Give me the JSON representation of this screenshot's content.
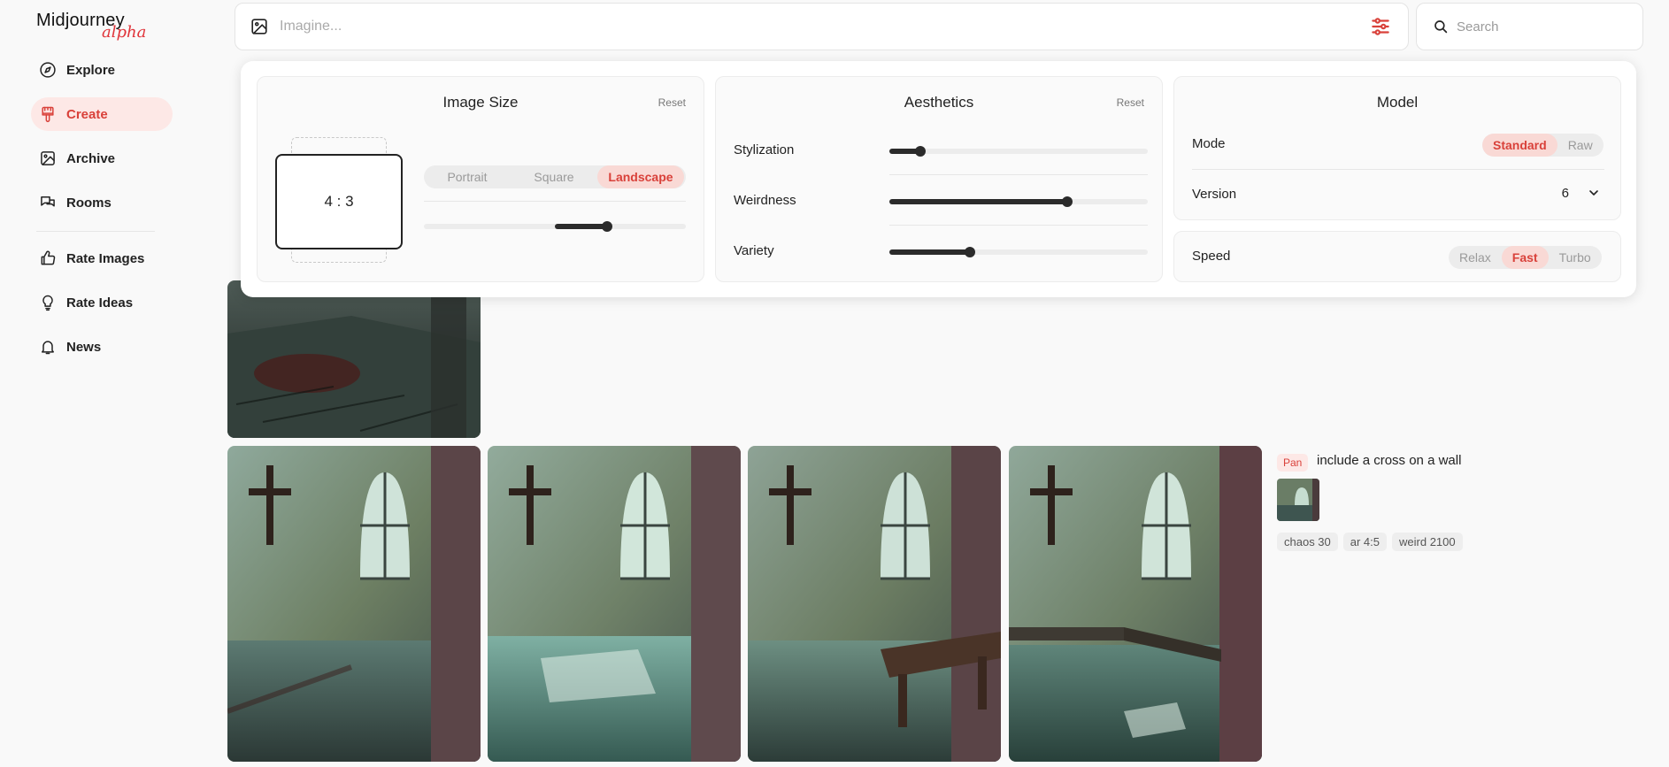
{
  "brand": {
    "name": "Midjourney",
    "tag": "alpha"
  },
  "nav": {
    "items": [
      {
        "label": "Explore",
        "icon": "compass-icon",
        "active": false
      },
      {
        "label": "Create",
        "icon": "brush-icon",
        "active": true
      },
      {
        "label": "Archive",
        "icon": "image-icon",
        "active": false
      },
      {
        "label": "Rooms",
        "icon": "chat-icon",
        "active": false
      },
      {
        "label": "Rate Images",
        "icon": "thumbs-up-icon",
        "active": false
      },
      {
        "label": "Rate Ideas",
        "icon": "lightbulb-icon",
        "active": false
      },
      {
        "label": "News",
        "icon": "bell-icon",
        "active": false
      }
    ]
  },
  "imagine": {
    "placeholder": "Imagine..."
  },
  "search": {
    "placeholder": "Search"
  },
  "settings": {
    "image_size": {
      "title": "Image Size",
      "reset": "Reset",
      "ratio": "4 : 3",
      "options": [
        "Portrait",
        "Square",
        "Landscape"
      ],
      "selected": "Landscape",
      "slider_value": 0.7
    },
    "aesthetics": {
      "title": "Aesthetics",
      "reset": "Reset",
      "sliders": [
        {
          "label": "Stylization",
          "value": 0.12
        },
        {
          "label": "Weirdness",
          "value": 0.69
        },
        {
          "label": "Variety",
          "value": 0.31
        }
      ]
    },
    "model": {
      "title": "Model",
      "mode_label": "Mode",
      "mode_options": [
        "Standard",
        "Raw"
      ],
      "mode_selected": "Standard",
      "version_label": "Version",
      "version_value": "6",
      "speed_label": "Speed",
      "speed_options": [
        "Relax",
        "Fast",
        "Turbo"
      ],
      "speed_selected": "Fast"
    }
  },
  "job": {
    "badge": "Pan",
    "prompt": "include a cross on a wall",
    "params": [
      "chaos 30",
      "ar 4:5",
      "weird 2100"
    ]
  },
  "colors": {
    "accent": "#d9413a",
    "accent_bg": "#fde8e6",
    "alpha": "#e0343a"
  }
}
